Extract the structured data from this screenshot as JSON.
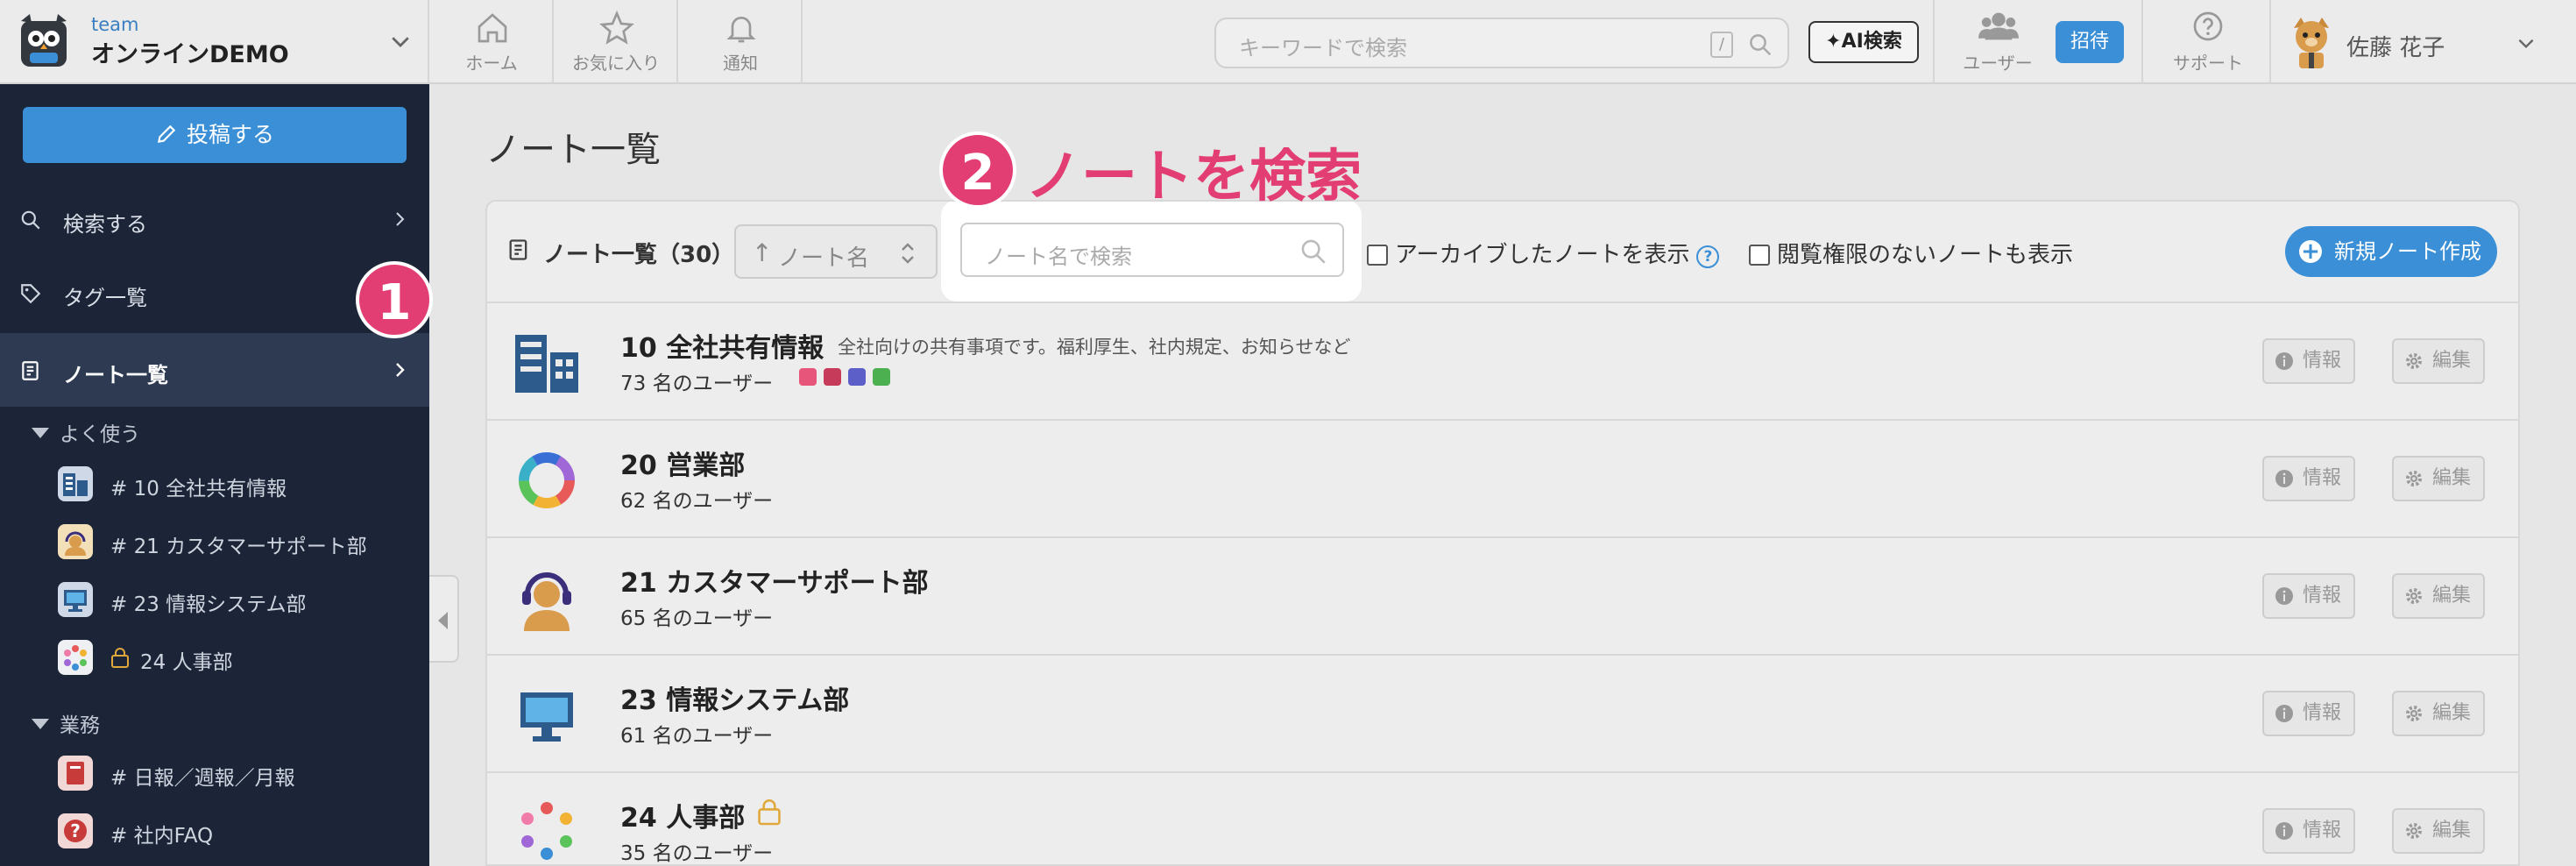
{
  "header": {
    "team_label": "team",
    "team_name": "オンラインDEMO",
    "nav": [
      {
        "label": "ホーム",
        "icon": "home-icon"
      },
      {
        "label": "お気に入り",
        "icon": "star-icon"
      },
      {
        "label": "通知",
        "icon": "bell-icon"
      }
    ],
    "search_placeholder": "キーワードで検索",
    "search_shortcut": "/",
    "ai_search_label": "AI検索",
    "users_label": "ユーザー",
    "invite_label": "招待",
    "support_label": "サポート",
    "user_name": "佐藤 花子"
  },
  "sidebar": {
    "post_button": "投稿する",
    "items": [
      {
        "label": "検索する",
        "icon": "search-icon"
      },
      {
        "label": "タグ一覧",
        "icon": "tag-icon"
      },
      {
        "label": "ノート一覧",
        "icon": "note-icon"
      }
    ],
    "sections": [
      {
        "title": "よく使う",
        "items": [
          {
            "label": "# 10 全社共有情報",
            "icon": "building-icon"
          },
          {
            "label": "# 21 カスタマーサポート部",
            "icon": "headset-icon"
          },
          {
            "label": "# 23 情報システム部",
            "icon": "monitor-icon"
          },
          {
            "label": "24 人事部",
            "icon": "dots-icon",
            "locked": true
          }
        ]
      },
      {
        "title": "業務",
        "items": [
          {
            "label": "# 日報／週報／月報",
            "icon": "book-icon"
          },
          {
            "label": "# 社内FAQ",
            "icon": "question-icon"
          }
        ]
      }
    ]
  },
  "main": {
    "page_title": "ノート一覧",
    "list_title": "ノート一覧（30）",
    "sort_label": "ノート名",
    "note_search_placeholder": "ノート名で検索",
    "show_archived_label": "アーカイブしたノートを表示",
    "show_no_permission_label": "閲覧権限のないノートも表示",
    "new_note_label": "新規ノート作成",
    "info_label": "情報",
    "edit_label": "編集",
    "notes": [
      {
        "name": "10 全社共有情報",
        "description": "全社向けの共有事項です。福利厚生、社内規定、お知らせなど",
        "users": "73 名のユーザー",
        "icon": "building-icon"
      },
      {
        "name": "20 営業部",
        "description": "",
        "users": "62 名のユーザー",
        "icon": "ring-chart-icon"
      },
      {
        "name": "21 カスタマーサポート部",
        "description": "",
        "users": "65 名のユーザー",
        "icon": "headset-icon"
      },
      {
        "name": "23 情報システム部",
        "description": "",
        "users": "61 名のユーザー",
        "icon": "monitor-icon"
      },
      {
        "name": "24 人事部",
        "description": "",
        "users": "35 名のユーザー",
        "icon": "dots-icon",
        "locked": true
      }
    ]
  },
  "annotations": {
    "step1": "1",
    "step2": "2",
    "step2_text": "ノートを検索"
  },
  "colors": {
    "accent": "#3a8fd6",
    "sidebar_bg": "#1c2538",
    "annotation": "#e33e74"
  }
}
